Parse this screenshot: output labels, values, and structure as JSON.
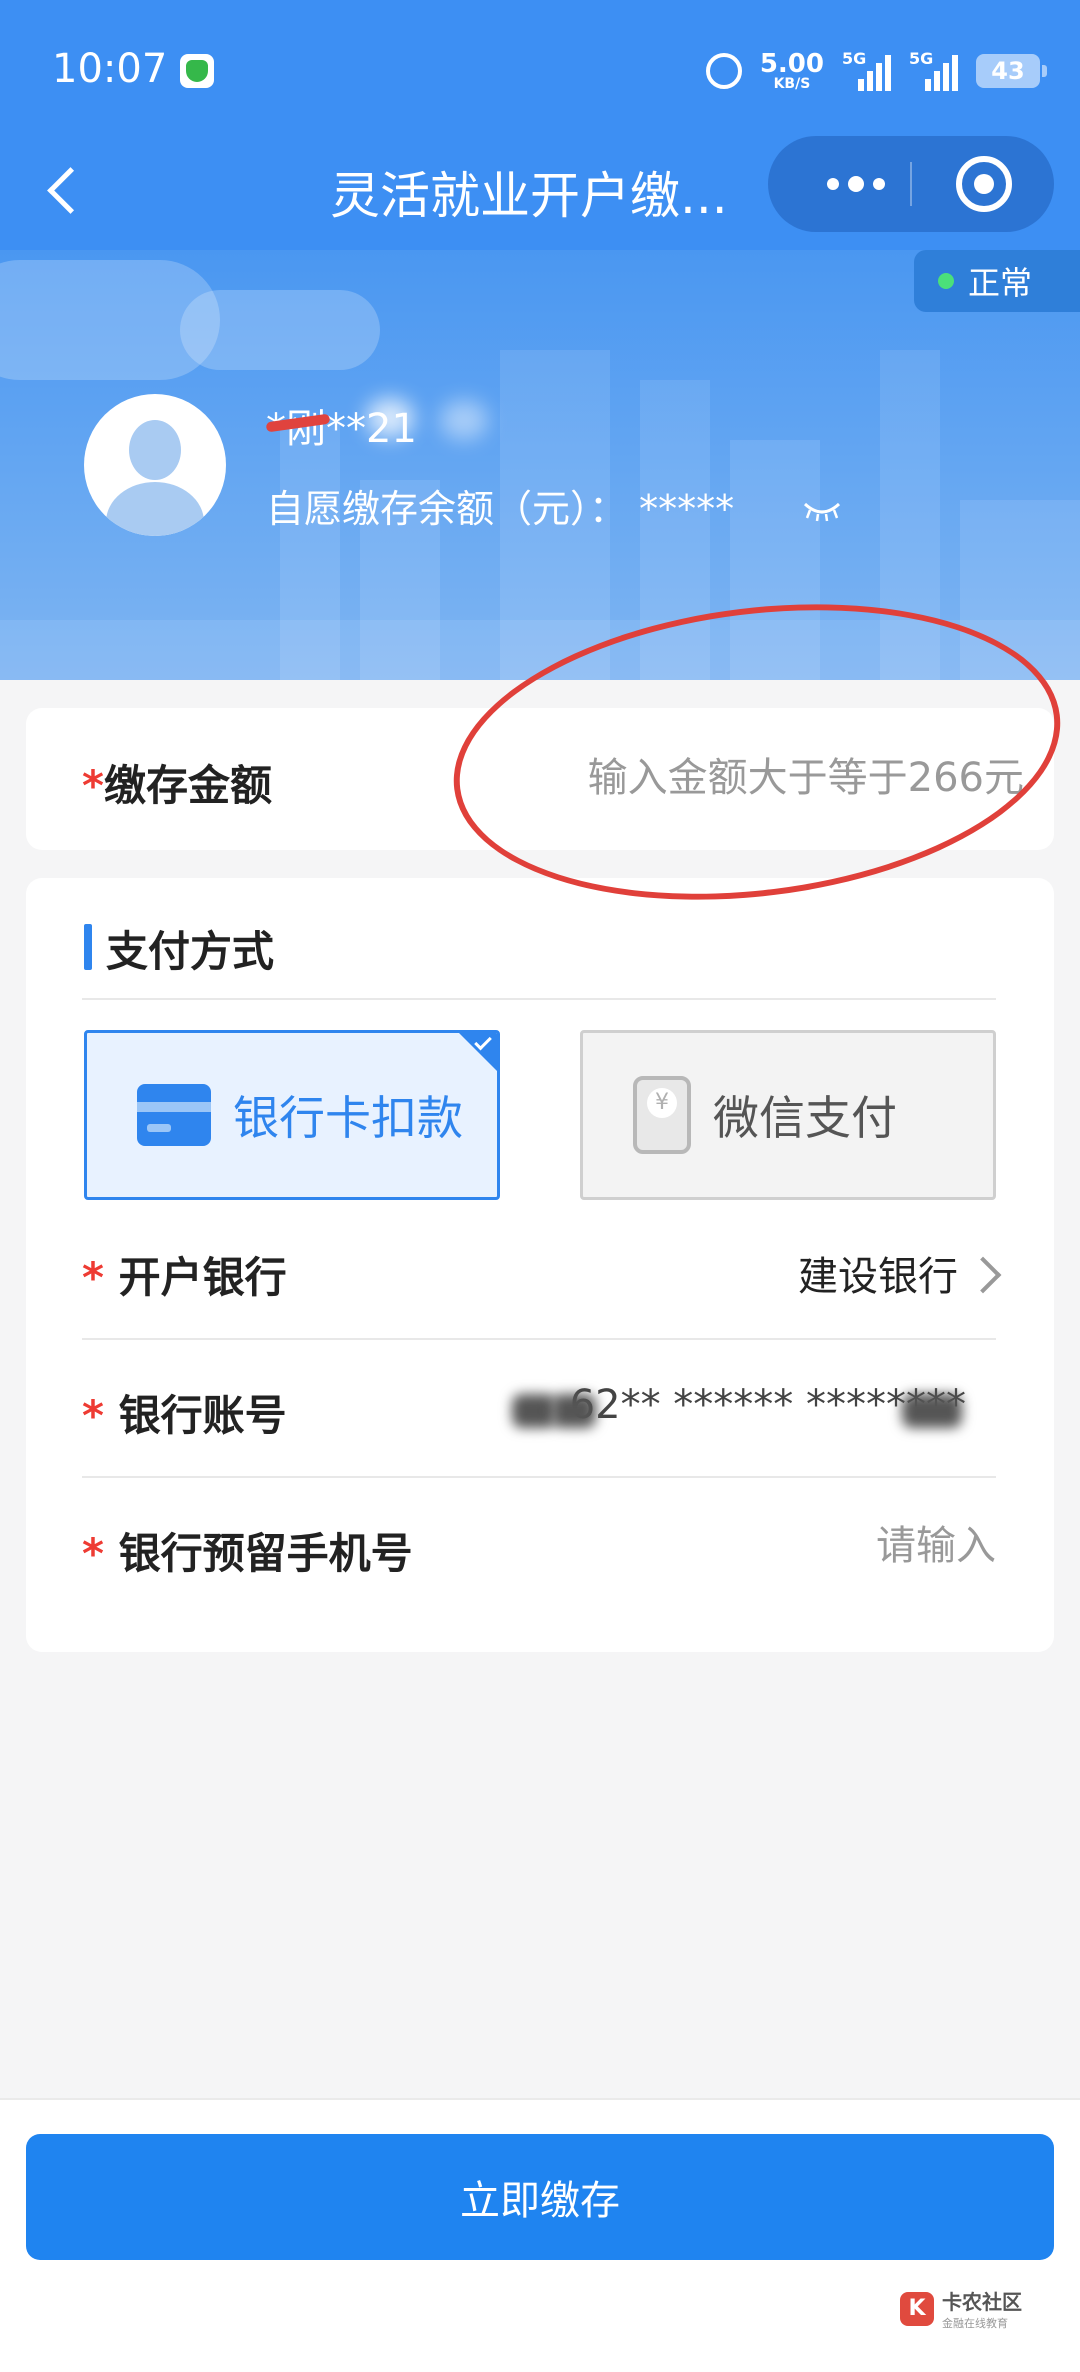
{
  "status_bar": {
    "time": "10:07",
    "net_speed": "5.00",
    "net_unit": "KB/S",
    "signal1": "5G",
    "signal2": "5G",
    "battery": "43"
  },
  "nav": {
    "title": "灵活就业开户缴..."
  },
  "banner": {
    "status": "正常",
    "user_masked": "*刚**21",
    "balance_label": "自愿缴存余额（元）：",
    "balance_value": "*****"
  },
  "deposit": {
    "label": "缴存金额",
    "required": "*",
    "placeholder": "输入金额大于等于266元"
  },
  "payment": {
    "section_title": "支付方式",
    "options": [
      {
        "label": "银行卡扣款",
        "selected": true
      },
      {
        "label": "微信支付",
        "selected": false
      }
    ],
    "bank": {
      "label": "开户银行",
      "value": "建设银行"
    },
    "account": {
      "label": "银行账号",
      "value": "62** ****** ********"
    },
    "phone": {
      "label": "银行预留手机号",
      "placeholder": "请输入"
    }
  },
  "submit": {
    "label": "立即缴存"
  },
  "watermark": {
    "title": "卡农社区",
    "subtitle": "金融在线教育"
  },
  "colors": {
    "primary": "#3d8ff3",
    "button": "#1f84f0",
    "required": "#ee3b33",
    "annotation": "#e0403a"
  }
}
